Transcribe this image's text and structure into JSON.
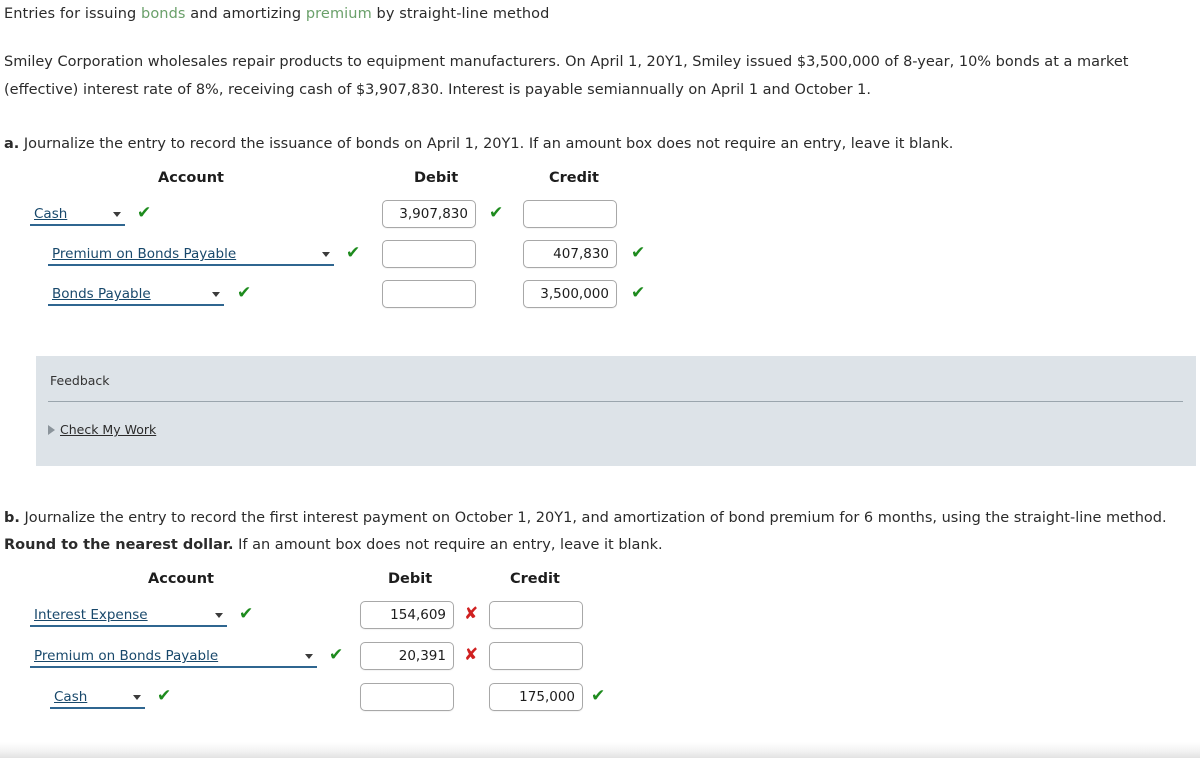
{
  "title": {
    "before": "Entries for issuing ",
    "kw1": "bonds",
    "middle": " and amortizing ",
    "kw2": "premium",
    "after": " by straight-line method"
  },
  "intro": "Smiley Corporation wholesales repair products to equipment manufacturers. On April 1, 20Y1, Smiley issued $3,500,000 of 8-year, 10% bonds at a market (effective) interest rate of 8%, receiving cash of $3,907,830. Interest is payable semiannually on April 1 and October 1.",
  "part_a": {
    "letter": "a.",
    "prompt": "Journalize the entry to record the issuance of bonds on April 1, 20Y1. If an amount box does not require an entry, leave it blank.",
    "headers": {
      "account": "Account",
      "debit": "Debit",
      "credit": "Credit"
    },
    "rows": [
      {
        "account": "Cash",
        "account_status": "correct",
        "debit": "3,907,830",
        "debit_status": "correct",
        "credit": "",
        "credit_status": "none"
      },
      {
        "account": "Premium on Bonds Payable",
        "account_status": "correct",
        "debit": "",
        "debit_status": "none",
        "credit": "407,830",
        "credit_status": "correct"
      },
      {
        "account": "Bonds Payable",
        "account_status": "correct",
        "debit": "",
        "debit_status": "none",
        "credit": "3,500,000",
        "credit_status": "correct"
      }
    ]
  },
  "feedback": {
    "title": "Feedback",
    "check_my_work": "Check My Work"
  },
  "part_b": {
    "letter": "b.",
    "prompt_1": "Journalize the entry to record the first interest payment on October 1, 20Y1, and amortization of bond premium for 6 months, using the straight-line method. ",
    "prompt_bold": "Round to the nearest dollar.",
    "prompt_2": " If an amount box does not require an entry, leave it blank.",
    "headers": {
      "account": "Account",
      "debit": "Debit",
      "credit": "Credit"
    },
    "rows": [
      {
        "account": "Interest Expense",
        "account_status": "correct",
        "debit": "154,609",
        "debit_status": "incorrect",
        "credit": "",
        "credit_status": "none"
      },
      {
        "account": "Premium on Bonds Payable",
        "account_status": "correct",
        "debit": "20,391",
        "debit_status": "incorrect",
        "credit": "",
        "credit_status": "none"
      },
      {
        "account": "Cash",
        "account_status": "correct",
        "debit": "",
        "debit_status": "none",
        "credit": "175,000",
        "credit_status": "correct"
      }
    ]
  },
  "marks": {
    "correct": "✔",
    "incorrect": "✘"
  },
  "colors": {
    "correct": "#1e8b1e",
    "incorrect": "#d02020",
    "keyword": "#6aa06a",
    "select_underline": "#2f6690",
    "feedback_bg": "#dde3e8"
  }
}
